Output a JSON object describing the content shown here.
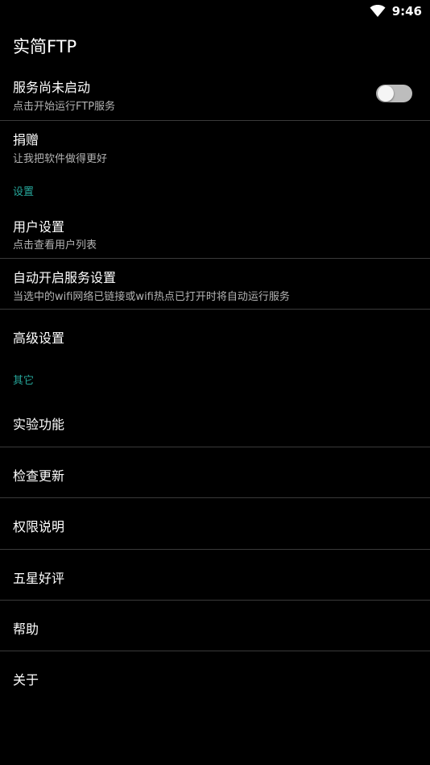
{
  "status_bar": {
    "time": "9:46"
  },
  "app": {
    "title": "实简FTP"
  },
  "service": {
    "title": "服务尚未启动",
    "subtitle": "点击开始运行FTP服务",
    "toggle_on": false
  },
  "donate": {
    "title": "捐赠",
    "subtitle": "让我把软件做得更好"
  },
  "settings_section": {
    "header": "设置"
  },
  "user_settings": {
    "title": "用户设置",
    "subtitle": "点击查看用户列表"
  },
  "auto_start": {
    "title": "自动开启服务设置",
    "subtitle": "当选中的wifi网络已链接或wifi热点已打开时将自动运行服务"
  },
  "advanced": {
    "title": "高级设置"
  },
  "other_section": {
    "header": "其它"
  },
  "other_items": [
    "实验功能",
    "检查更新",
    "权限说明",
    "五星好评",
    "帮助",
    "关于"
  ],
  "colors": {
    "accent": "#26a69a",
    "background": "#000000",
    "divider": "#3a3a3a"
  }
}
